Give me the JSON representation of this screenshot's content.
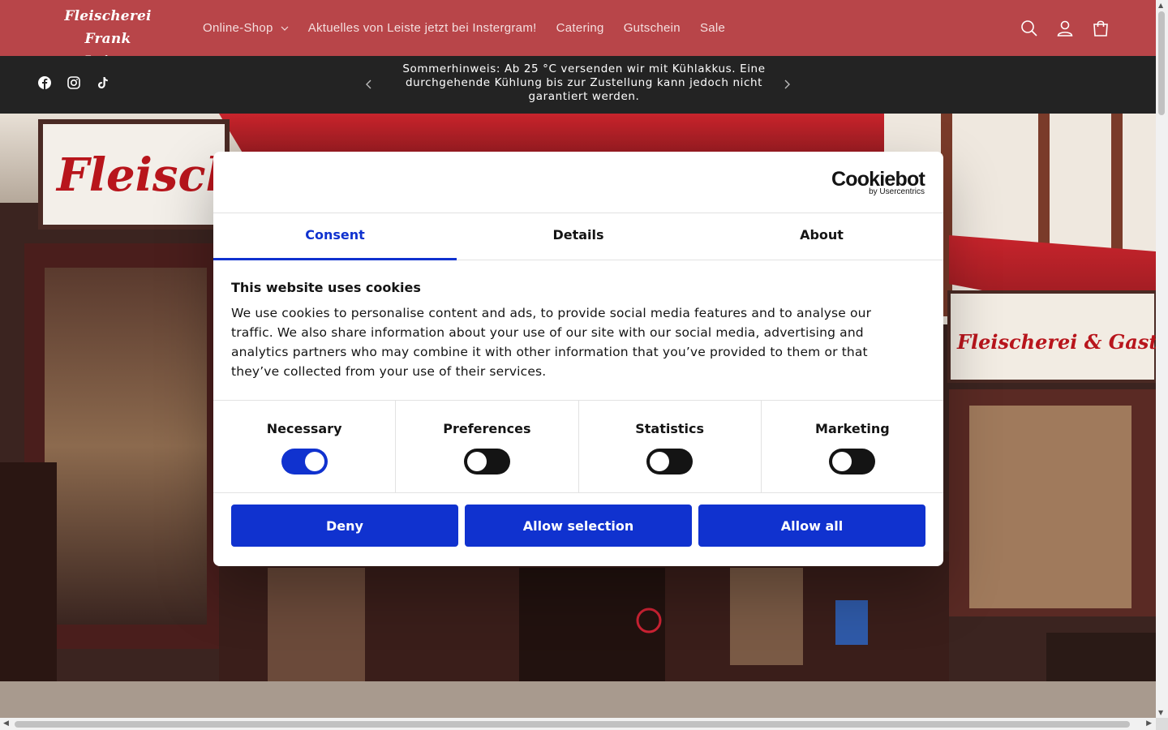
{
  "header": {
    "logo_line1": "Fleischerei",
    "logo_line2": "Frank Leiste",
    "nav": [
      {
        "label": "Online-Shop"
      },
      {
        "label": "Aktuelles von Leiste jetzt bei Instergram!"
      },
      {
        "label": "Catering"
      },
      {
        "label": "Gutschein"
      },
      {
        "label": "Sale"
      }
    ],
    "icons": [
      "search-icon",
      "account-icon",
      "cart-icon"
    ]
  },
  "announcement": {
    "text": "Sommerhinweis: Ab 25 °C versenden wir mit Kühlakkus. Eine durchgehende Kühlung bis zur Zustellung kann jedoch nicht garantiert werden.",
    "social": [
      "facebook-icon",
      "instagram-icon",
      "tiktok-icon"
    ]
  },
  "cookie_dialog": {
    "brand": "Cookiebot",
    "brand_sub": "by Usercentrics",
    "tabs": [
      {
        "label": "Consent",
        "active": true
      },
      {
        "label": "Details",
        "active": false
      },
      {
        "label": "About",
        "active": false
      }
    ],
    "title": "This website uses cookies",
    "text": "We use cookies to personalise content and ads, to provide social media features and to analyse our traffic. We also share information about your use of our site with our social media, advertising and analytics partners who may combine it with other information that you’ve provided to them or that they’ve collected from your use of their services.",
    "toggles": [
      {
        "label": "Necessary",
        "on": true
      },
      {
        "label": "Preferences",
        "on": false
      },
      {
        "label": "Statistics",
        "on": false
      },
      {
        "label": "Marketing",
        "on": false
      }
    ],
    "buttons": {
      "deny": "Deny",
      "allow_selection": "Allow selection",
      "allow_all": "Allow all"
    }
  },
  "colors": {
    "header_bg": "#b84549",
    "announce_bg": "#232323",
    "accent": "#1032cf"
  }
}
